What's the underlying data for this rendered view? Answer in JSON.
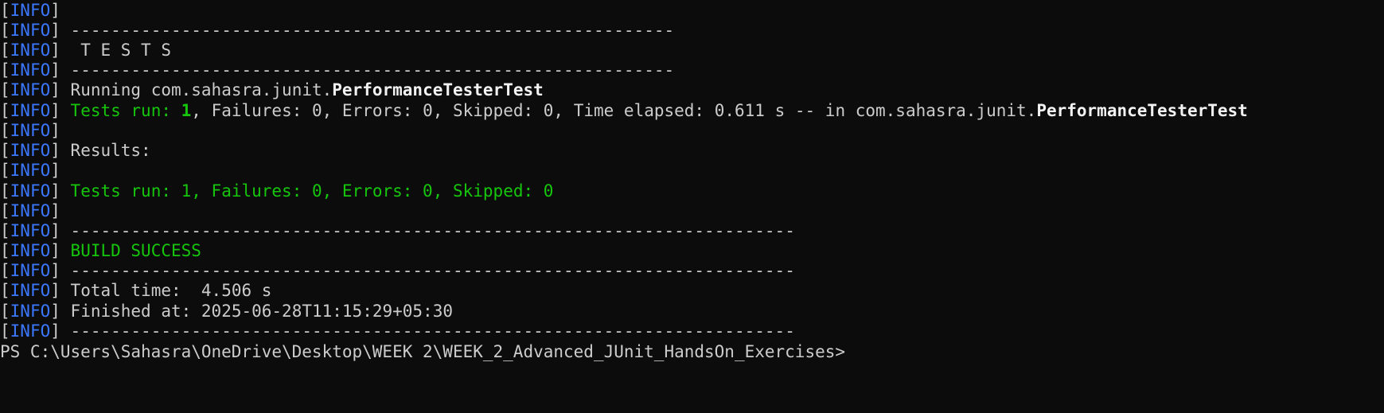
{
  "terminal": {
    "log_tag": "INFO",
    "lines": [
      {
        "text": ""
      },
      {
        "text": "------------------------------------------------------------"
      },
      {
        "text": " T E S T S"
      },
      {
        "text": "------------------------------------------------------------"
      },
      {
        "text": "Running com.sahasra.junit.",
        "text_bold": "PerformanceTesterTest"
      },
      {
        "text_green": "Tests run: ",
        "text_green_bold": "1",
        "text": ", Failures: 0, Errors: 0, Skipped: 0, Time elapsed: 0.611 s -- in com.sahasra.junit.",
        "text_bold": "PerformanceTesterTest"
      },
      {
        "text": ""
      },
      {
        "text": "Results:"
      },
      {
        "text": ""
      },
      {
        "text_green": "Tests run: 1, Failures: 0, Errors: 0, Skipped: 0"
      },
      {
        "text": ""
      },
      {
        "text": "------------------------------------------------------------------------"
      },
      {
        "text_green": "BUILD SUCCESS"
      },
      {
        "text": "------------------------------------------------------------------------"
      },
      {
        "text": "Total time:  4.506 s"
      },
      {
        "text": "Finished at: 2025-06-28T11:15:29+05:30"
      },
      {
        "text": "------------------------------------------------------------------------"
      }
    ],
    "prompt": "PS C:\\Users\\Sahasra\\OneDrive\\Desktop\\WEEK 2\\WEEK_2_Advanced_JUnit_HandsOn_Exercises>"
  },
  "colors": {
    "background": "#0c0c0c",
    "default_text": "#cccccc",
    "info_tag": "#3b78ff",
    "success_green": "#16c60c"
  }
}
